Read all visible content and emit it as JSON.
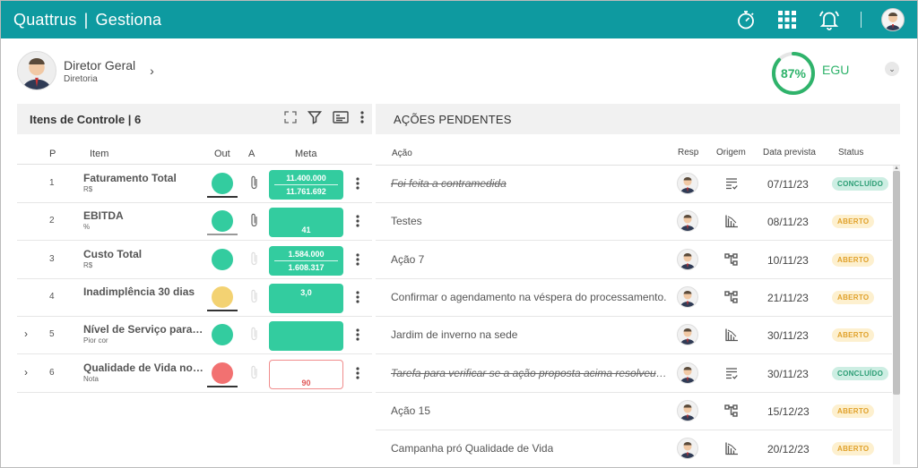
{
  "app": {
    "brand": "Quattrus",
    "module": "Gestiona"
  },
  "topbar": {
    "icons": [
      "stopwatch-icon",
      "apps-grid-icon",
      "bell-icon",
      "user-avatar"
    ]
  },
  "profile": {
    "name": "Diretor Geral",
    "role": "Diretoria"
  },
  "gauge": {
    "value_text": "87%",
    "percent": 87,
    "label": "EGU",
    "color": "#2fb36b"
  },
  "left_panel": {
    "title": "Itens de Controle | 6",
    "columns": {
      "p": "P",
      "item": "Item",
      "out": "Out",
      "a": "A",
      "meta": "Meta"
    },
    "rows": [
      {
        "p": "1",
        "name": "Faturamento Total",
        "unit": "R$",
        "status": "green",
        "underline": "black",
        "attachment": true,
        "meta_top": "11.400.000",
        "meta_bottom": "11.761.692",
        "meta_style": "split",
        "expandable": false
      },
      {
        "p": "2",
        "name": "EBITDA",
        "unit": "%",
        "status": "green",
        "underline": "gray",
        "attachment": true,
        "meta_top": "",
        "meta_bottom": "41",
        "meta_style": "single",
        "expandable": false
      },
      {
        "p": "3",
        "name": "Custo Total",
        "unit": "R$",
        "status": "green",
        "underline": "none",
        "attachment": false,
        "meta_top": "1.584.000",
        "meta_bottom": "1.608.317",
        "meta_style": "split",
        "expandable": false
      },
      {
        "p": "4",
        "name": "Inadimplência 30 dias",
        "unit": "",
        "status": "yellow",
        "underline": "black",
        "attachment": false,
        "meta_top": "3,0",
        "meta_bottom": "",
        "meta_style": "single",
        "expandable": false
      },
      {
        "p": "5",
        "name": "Nível de Serviço para o Cliente",
        "unit": "Pior cor",
        "status": "green",
        "underline": "none",
        "attachment": false,
        "meta_top": "",
        "meta_bottom": "",
        "meta_style": "single",
        "expandable": true
      },
      {
        "p": "6",
        "name": "Qualidade de Vida no Trabalho",
        "unit": "Nota",
        "status": "red",
        "underline": "black",
        "attachment": false,
        "meta_top": "",
        "meta_bottom": "90",
        "meta_style": "red",
        "expandable": true
      }
    ]
  },
  "right_panel": {
    "title": "AÇÕES PENDENTES",
    "columns": {
      "acao": "Ação",
      "resp": "Resp",
      "origem": "Origem",
      "data": "Data prevista",
      "status": "Status"
    },
    "rows": [
      {
        "acao": "Foi feita a contramedida",
        "origem": "checklist-icon",
        "data": "07/11/23",
        "status": "CONCLUÍDO",
        "done": true
      },
      {
        "acao": "Testes",
        "origem": "pareto-chart-icon",
        "data": "08/11/23",
        "status": "ABERTO",
        "done": false
      },
      {
        "acao": "Ação 7",
        "origem": "hierarchy-icon",
        "data": "10/11/23",
        "status": "ABERTO",
        "done": false
      },
      {
        "acao": "Confirmar o agendamento na véspera do processamento.",
        "origem": "hierarchy-icon",
        "data": "21/11/23",
        "status": "ABERTO",
        "done": false
      },
      {
        "acao": "Jardim de inverno na sede",
        "origem": "pareto-chart-icon",
        "data": "30/11/23",
        "status": "ABERTO",
        "done": false
      },
      {
        "acao": "Tarefa para verificar se a ação proposta acima resolveu o problema",
        "origem": "checklist-icon",
        "data": "30/11/23",
        "status": "CONCLUÍDO",
        "done": true
      },
      {
        "acao": "Ação 15",
        "origem": "hierarchy-icon",
        "data": "15/12/23",
        "status": "ABERTO",
        "done": false
      },
      {
        "acao": "Campanha pró Qualidade de Vida",
        "origem": "pareto-chart-icon",
        "data": "20/12/23",
        "status": "ABERTO",
        "done": false
      }
    ]
  },
  "colors": {
    "teal": "#0e9aa0",
    "green": "#33cc9f",
    "yellow": "#f3d272",
    "red": "#f27171"
  }
}
